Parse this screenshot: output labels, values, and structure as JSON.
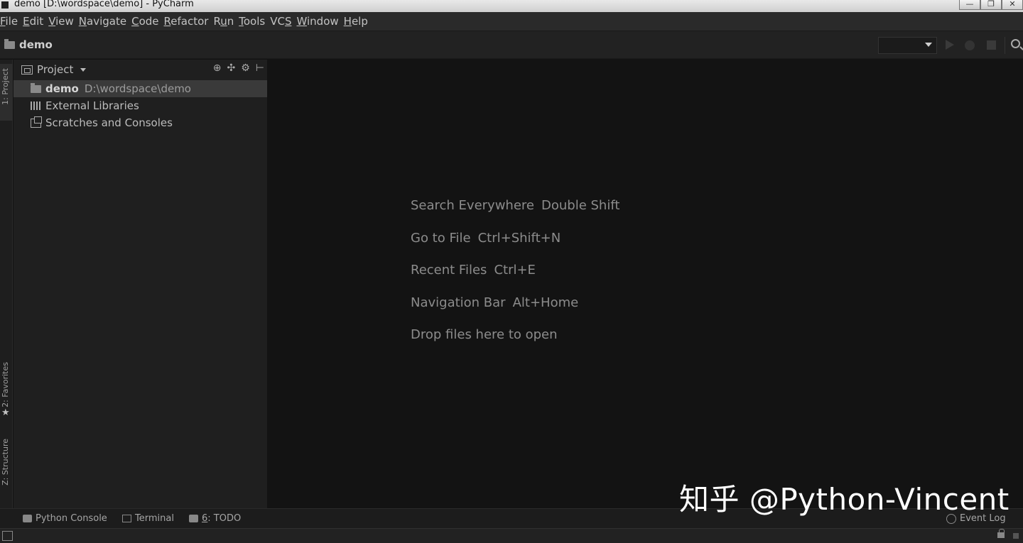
{
  "window": {
    "title": "demo [D:\\wordspace\\demo] - PyCharm",
    "minimize": "—",
    "maximize": "❐",
    "close": "✕"
  },
  "menu": {
    "items": [
      {
        "u": "F",
        "rest": "ile"
      },
      {
        "u": "E",
        "rest": "dit"
      },
      {
        "u": "V",
        "rest": "iew"
      },
      {
        "u": "N",
        "rest": "avigate"
      },
      {
        "u": "C",
        "rest": "ode"
      },
      {
        "u": "R",
        "rest": "efactor"
      },
      {
        "pre": "R",
        "u": "u",
        "rest": "n"
      },
      {
        "u": "T",
        "rest": "ools"
      },
      {
        "pre": "VC",
        "u": "S",
        "rest": ""
      },
      {
        "u": "W",
        "rest": "indow"
      },
      {
        "u": "H",
        "rest": "elp"
      }
    ]
  },
  "navbar": {
    "crumb": "demo"
  },
  "left_stripe": {
    "project_tab": "1: Project",
    "favorites_tab": "2: Favorites",
    "structure_tab": "Z: Structure"
  },
  "project_panel": {
    "title": "Project",
    "tree": {
      "root_name": "demo",
      "root_path": "D:\\wordspace\\demo",
      "libraries": "External Libraries",
      "scratches": "Scratches and Consoles"
    }
  },
  "editor": {
    "hints": [
      {
        "label": "Search Everywhere",
        "key": "Double Shift"
      },
      {
        "label": "Go to File",
        "key": "Ctrl+Shift+N"
      },
      {
        "label": "Recent Files",
        "key": "Ctrl+E"
      },
      {
        "label": "Navigation Bar",
        "key": "Alt+Home"
      },
      {
        "label": "Drop files here to open",
        "key": ""
      }
    ]
  },
  "bottom_bar": {
    "python_console": "Python Console",
    "terminal": "Terminal",
    "todo_num": "6",
    "todo_label": ": TODO",
    "event_log": "Event Log"
  },
  "watermark": "知乎 @Python-Vincent"
}
